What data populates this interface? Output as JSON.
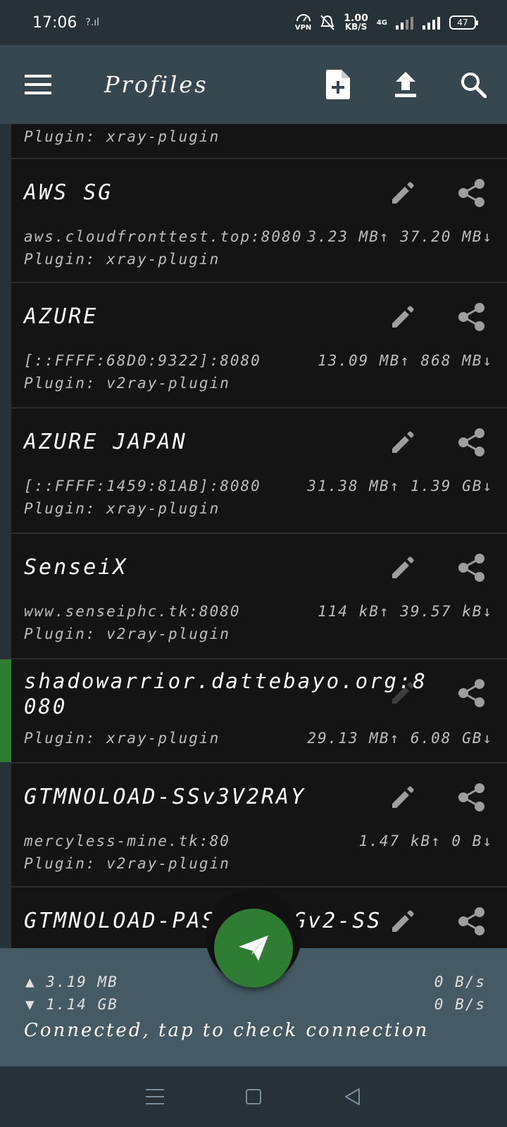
{
  "status_bar": {
    "time": "17:06",
    "vpn": "VPN",
    "speed_value": "1.00",
    "speed_unit": "KB/S",
    "network": "4G",
    "battery": "47"
  },
  "toolbar": {
    "title": "Profiles",
    "icons": [
      "menu-icon",
      "add-file-icon",
      "upload-icon",
      "search-icon"
    ]
  },
  "profiles": [
    {
      "name": "",
      "host": "",
      "plugin": "Plugin: xray-plugin",
      "traffic": ""
    },
    {
      "name": "AWS SG",
      "host": "aws.cloudfronttest.top:8080",
      "plugin": "Plugin: xray-plugin",
      "traffic": "3.23 MB↑ 37.20 MB↓"
    },
    {
      "name": "AZURE",
      "host": "[::FFFF:68D0:9322]:8080",
      "plugin": "Plugin: v2ray-plugin",
      "traffic": "13.09 MB↑ 868 MB↓"
    },
    {
      "name": "AZURE JAPAN",
      "host": "[::FFFF:1459:81AB]:8080",
      "plugin": "Plugin: xray-plugin",
      "traffic": "31.38 MB↑ 1.39 GB↓"
    },
    {
      "name": "SenseiX",
      "host": "www.senseiphc.tk:8080",
      "plugin": "Plugin: v2ray-plugin",
      "traffic": "114 kB↑ 39.57 kB↓"
    },
    {
      "name": "shadowarrior.dattebayo.org:8",
      "name_line2": "080",
      "plugin": "Plugin: xray-plugin",
      "traffic": "29.13 MB↑ 6.08 GB↓",
      "active": true
    },
    {
      "name": "GTMNOLOAD-SSv3V2RAY",
      "host": "mercyless-mine.tk:80",
      "plugin": "Plugin: v2ray-plugin",
      "traffic": "1.47 kB↑ 0 B↓"
    },
    {
      "name": "GTMNOLOAD-PAS",
      "name_tail": "Gv2-SS"
    }
  ],
  "bottom": {
    "upload_total": "▲ 3.19 MB",
    "download_total": "▼ 1.14 GB",
    "upload_rate": "0 B/s",
    "download_rate": "0 B/s",
    "status": "Connected, tap to check connection"
  },
  "colors": {
    "toolbar": "#37474f",
    "statusbar": "#263238",
    "card": "#141414",
    "active_indicator": "#2e7d32",
    "fab": "#2e7d32",
    "bottom_bar": "#455a64"
  }
}
